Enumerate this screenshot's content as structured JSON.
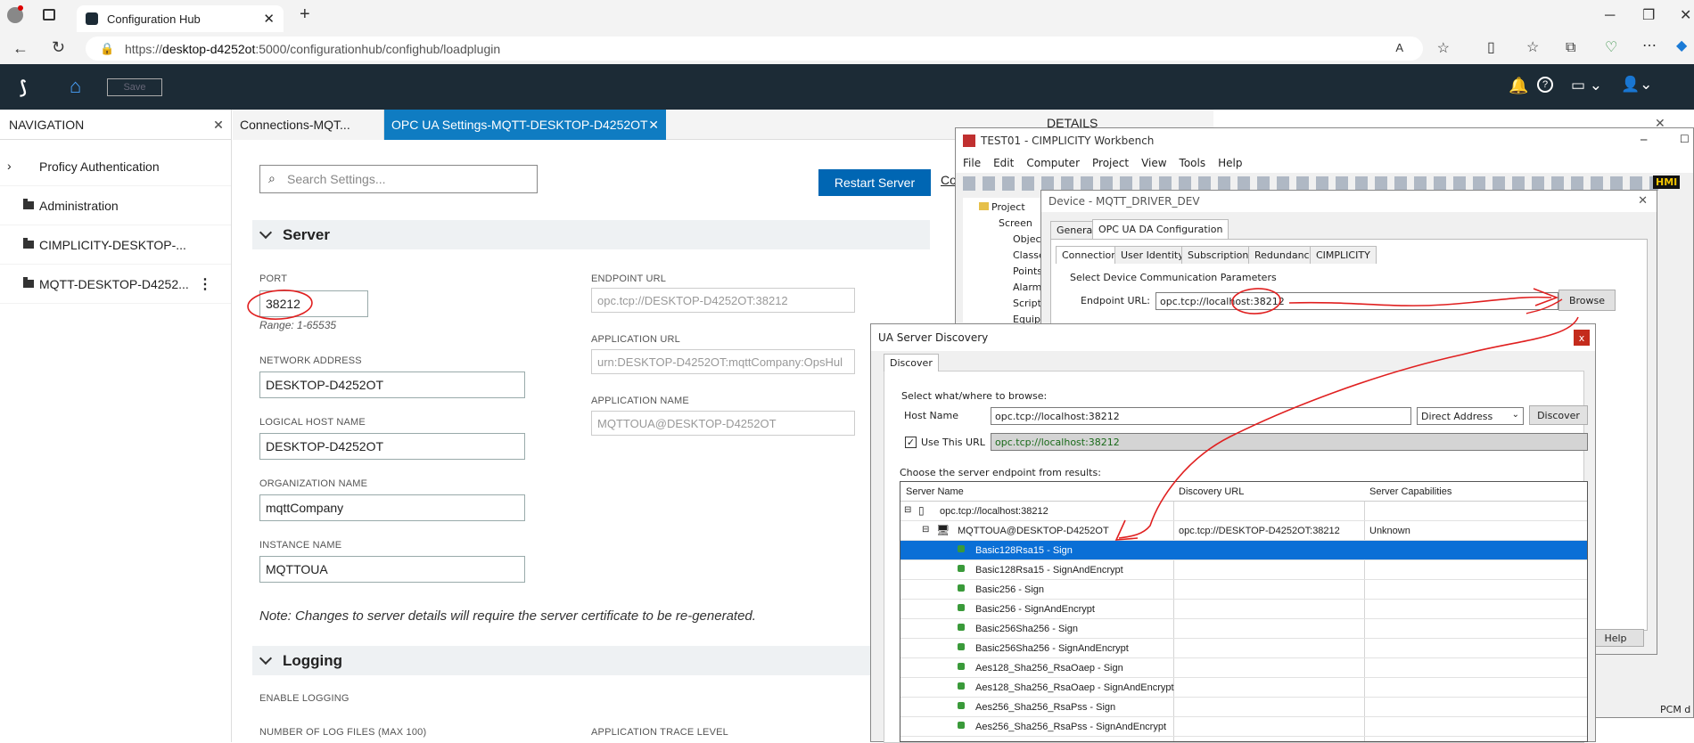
{
  "browser": {
    "tab_title": "Configuration Hub",
    "url_prefix": "https://",
    "url_host": "desktop-d4252ot",
    "url_rest": ":5000/configurationhub/confighub/loadplugin"
  },
  "app": {
    "save_label": "Save"
  },
  "nav": {
    "header": "NAVIGATION",
    "items": [
      {
        "label": "Proficy Authentication"
      },
      {
        "label": "Administration"
      },
      {
        "label": "CIMPLICITY-DESKTOP-..."
      },
      {
        "label": "MQTT-DESKTOP-D4252..."
      }
    ]
  },
  "tabs": [
    {
      "label": "Connections-MQT..."
    },
    {
      "label": "OPC UA Settings-MQTT-DESKTOP-D4252OT"
    }
  ],
  "details_header": "DETAILS",
  "settings": {
    "search_placeholder": "Search Settings...",
    "restart_label": "Restart Server",
    "co_label": "Co",
    "server_section": "Server",
    "port_label": "PORT",
    "port_value": "38212",
    "port_range": "Range: 1-65535",
    "network_label": "NETWORK ADDRESS",
    "network_value": "DESKTOP-D4252OT",
    "logical_label": "LOGICAL HOST NAME",
    "logical_value": "DESKTOP-D4252OT",
    "org_label": "ORGANIZATION NAME",
    "org_value": "mqttCompany",
    "instance_label": "INSTANCE NAME",
    "instance_value": "MQTTOUA",
    "endpoint_label": "ENDPOINT URL",
    "endpoint_value": "opc.tcp://DESKTOP-D4252OT:38212",
    "appurl_label": "APPLICATION URL",
    "appurl_value": "urn:DESKTOP-D4252OT:mqttCompany:OpsHul",
    "appname_label": "APPLICATION NAME",
    "appname_value": "MQTTOUA@DESKTOP-D4252OT",
    "note": "Note: Changes to server details will require the server certificate to be re-generated.",
    "logging_section": "Logging",
    "enable_logging": "ENABLE LOGGING",
    "num_log_files": "NUMBER OF LOG FILES (MAX 100)",
    "trace_level": "APPLICATION TRACE LEVEL"
  },
  "workbench": {
    "title": "TEST01 - CIMPLICITY Workbench",
    "menu": [
      "File",
      "Edit",
      "Computer",
      "Project",
      "View",
      "Tools",
      "Help"
    ],
    "hmi_label": "HMI",
    "tree": [
      "Project",
      "Screen",
      "Objec",
      "Classe",
      "Points",
      "Alarm",
      "Script",
      "Equip"
    ]
  },
  "device": {
    "title": "Device - MQTT_DRIVER_DEV",
    "tabs": [
      "General",
      "OPC UA DA Configuration"
    ],
    "subtabs": [
      "Connection",
      "User Identity",
      "Subscriptions",
      "Redundancy",
      "CIMPLICITY"
    ],
    "group_label": "Select Device Communication Parameters",
    "endpoint_label": "Endpoint URL:",
    "endpoint_value": "opc.tcp://localhost:38212",
    "browse_label": "Browse",
    "help_label": "Help"
  },
  "discovery": {
    "title": "UA Server Discovery",
    "tab": "Discover",
    "group_label": "Select what/where to browse:",
    "host_label": "Host Name",
    "host_value": "opc.tcp://localhost:38212",
    "mode_value": "Direct Address",
    "discover_label": "Discover",
    "use_url_label": "Use This URL",
    "use_url_value": "opc.tcp://localhost:38212",
    "choose_label": "Choose the server endpoint from results:",
    "columns": [
      "Server Name",
      "Discovery URL",
      "Server Capabilities"
    ],
    "root": "opc.tcp://localhost:38212",
    "server": {
      "name": "MQTTOUA@DESKTOP-D4252OT",
      "url": "opc.tcp://DESKTOP-D4252OT:38212",
      "caps": "Unknown"
    },
    "endpoints": [
      "Basic128Rsa15 - Sign",
      "Basic128Rsa15 - SignAndEncrypt",
      "Basic256 - Sign",
      "Basic256 - SignAndEncrypt",
      "Basic256Sha256 - Sign",
      "Basic256Sha256 - SignAndEncrypt",
      "Aes128_Sha256_RsaOaep - Sign",
      "Aes128_Sha256_RsaOaep - SignAndEncrypt",
      "Aes256_Sha256_RsaPss - Sign",
      "Aes256_Sha256_RsaPss - SignAndEncrypt"
    ],
    "selected_index": 0
  },
  "status_text": "PCM d",
  "colors": {
    "header_bg": "#1c2b36",
    "accent": "#0066b3",
    "selected": "#0a6fd6",
    "annotation": "#e02020"
  }
}
